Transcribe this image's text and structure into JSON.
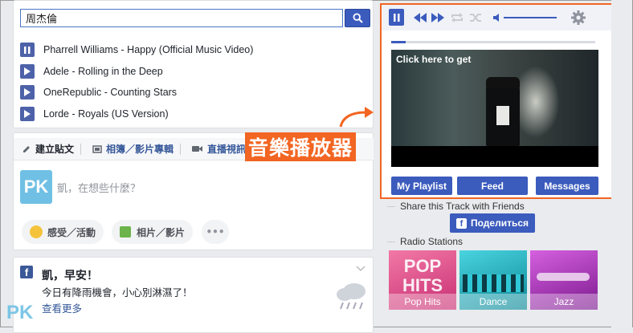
{
  "search": {
    "value": "周杰倫"
  },
  "tracks": [
    {
      "title": "Pharrell Williams - Happy (Official Music Video)",
      "state": "pause"
    },
    {
      "title": "Adele - Rolling in the Deep",
      "state": "play"
    },
    {
      "title": "OneRepublic - Counting Stars",
      "state": "play"
    },
    {
      "title": "Lorde - Royals (US Version)",
      "state": "play"
    }
  ],
  "composer": {
    "tabs": [
      "建立貼文",
      "相簿／影片專輯",
      "直播視訊"
    ],
    "avatar_text": "PK",
    "placeholder": "凱，在想些什麼？",
    "actions": [
      "感受／活動",
      "相片／影片",
      "•••"
    ]
  },
  "post": {
    "title": "凱，早安！",
    "body": "今日有降雨機會，小心別淋濕了！",
    "link": "查看更多"
  },
  "player": {
    "progress": 0.07,
    "video_caption": "Click here to get",
    "buttons": [
      "My Playlist",
      "Feed",
      "Messages"
    ],
    "annotation": "音樂播放器"
  },
  "share": {
    "title": "Share this Track with Friends",
    "button": "Поделиться"
  },
  "radio": {
    "title": "Radio Stations",
    "stations": [
      {
        "label": "Pop Hits",
        "art_text": "POP HITS",
        "color": "#e0457f"
      },
      {
        "label": "Dance",
        "art_text": "",
        "color": "#1fb7c8"
      },
      {
        "label": "Jazz",
        "art_text": "",
        "color": "#b03cc0"
      }
    ]
  },
  "colors": {
    "accent": "#3b5bbd",
    "annotation": "#f26522"
  }
}
